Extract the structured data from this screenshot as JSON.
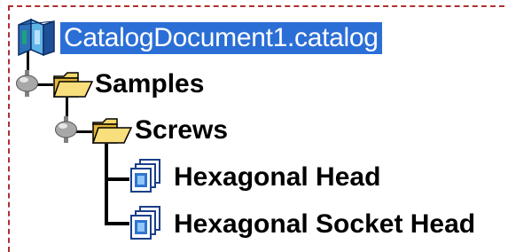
{
  "tree": {
    "root": {
      "label": "CatalogDocument1.catalog",
      "icon": "catalog-book-icon",
      "selected": true
    },
    "nodes": [
      {
        "label": "Samples",
        "icon": "open-folder-icon",
        "expander": "gray-node-icon"
      },
      {
        "label": "Screws",
        "icon": "open-folder-icon",
        "expander": "gray-node-icon"
      },
      {
        "label": "Hexagonal Head",
        "icon": "document-icon"
      },
      {
        "label": "Hexagonal Socket Head",
        "icon": "document-icon"
      }
    ]
  },
  "colors": {
    "selection": "#2b6fd6",
    "frame": "#b03030",
    "folder": "#f2c94c"
  }
}
